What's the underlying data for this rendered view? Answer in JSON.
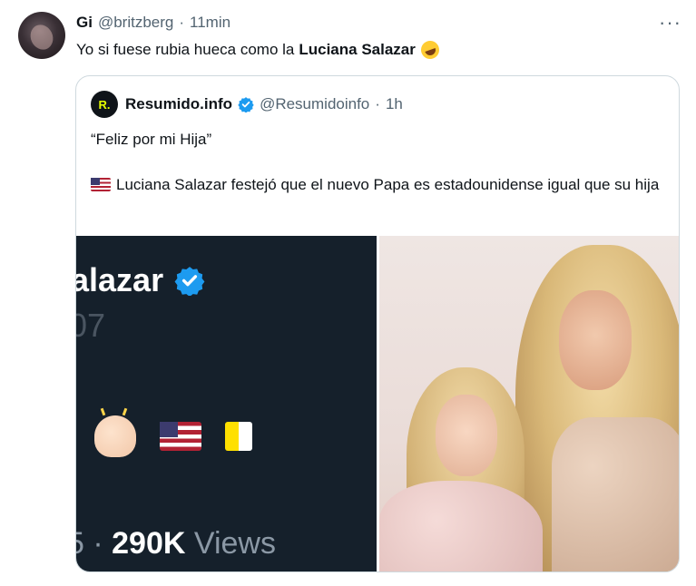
{
  "tweet": {
    "display_name": "Gi",
    "handle": "@britzberg",
    "separator": "·",
    "time": "11min",
    "more_label": "···",
    "text_prefix": "Yo si fuese rubia hueca como la",
    "text_bold": "Luciana Salazar",
    "emoji_icon": "rolling-on-floor-laughing-icon"
  },
  "quote": {
    "logo_text": "R.",
    "display_name": "Resumido.info",
    "handle": "@Resumidoinfo",
    "separator": "·",
    "time": "1h",
    "line1": "“Feliz por mi Hija”",
    "line2": "Luciana Salazar festejó que el nuevo Papa es estadounidense igual que su hija",
    "flag_icon": "us-flag-icon"
  },
  "media_left": {
    "name_fragment": "alazar",
    "number_fragment": "07",
    "views_prefix": "5 ·",
    "views_count": "290K",
    "views_label": "Views"
  },
  "colors": {
    "verified": "#1d9bf0",
    "muted": "#536471",
    "dark_bg": "#15202b"
  }
}
